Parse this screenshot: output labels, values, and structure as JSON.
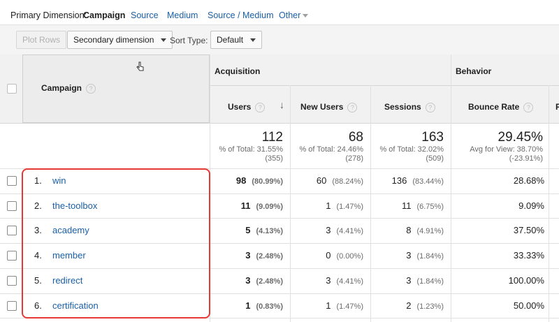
{
  "dimension_bar": {
    "label": "Primary Dimension:",
    "options": [
      "Campaign",
      "Source",
      "Medium",
      "Source / Medium",
      "Other"
    ],
    "selected": "Campaign"
  },
  "toolbar": {
    "plot_rows": "Plot Rows",
    "secondary_dimension": "Secondary dimension",
    "sort_type_label": "Sort Type:",
    "sort_type_value": "Default"
  },
  "table": {
    "group_headers": {
      "acquisition": "Acquisition",
      "behavior": "Behavior"
    },
    "columns": {
      "campaign": "Campaign",
      "users": "Users",
      "new_users": "New Users",
      "sessions": "Sessions",
      "bounce_rate": "Bounce Rate",
      "next": "P"
    },
    "help_glyph": "?",
    "sort_arrow": "↓",
    "totals": {
      "users": {
        "value": "112",
        "line1": "% of Total: 31.55%",
        "line2": "(355)"
      },
      "new_users": {
        "value": "68",
        "line1": "% of Total: 24.46%",
        "line2": "(278)"
      },
      "sessions": {
        "value": "163",
        "line1": "% of Total: 32.02%",
        "line2": "(509)"
      },
      "bounce_rate": {
        "value": "29.45%",
        "line1": "Avg for View: 38.70%",
        "line2": "(-23.91%)"
      }
    },
    "rows": [
      {
        "num": "1.",
        "campaign": "win",
        "users": "98",
        "users_pct": "(80.99%)",
        "new_users": "60",
        "new_users_pct": "(88.24%)",
        "sessions": "136",
        "sessions_pct": "(83.44%)",
        "bounce_rate": "28.68%"
      },
      {
        "num": "2.",
        "campaign": "the-toolbox",
        "users": "11",
        "users_pct": "(9.09%)",
        "new_users": "1",
        "new_users_pct": "(1.47%)",
        "sessions": "11",
        "sessions_pct": "(6.75%)",
        "bounce_rate": "9.09%"
      },
      {
        "num": "3.",
        "campaign": "academy",
        "users": "5",
        "users_pct": "(4.13%)",
        "new_users": "3",
        "new_users_pct": "(4.41%)",
        "sessions": "8",
        "sessions_pct": "(4.91%)",
        "bounce_rate": "37.50%"
      },
      {
        "num": "4.",
        "campaign": "member",
        "users": "3",
        "users_pct": "(2.48%)",
        "new_users": "0",
        "new_users_pct": "(0.00%)",
        "sessions": "3",
        "sessions_pct": "(1.84%)",
        "bounce_rate": "33.33%"
      },
      {
        "num": "5.",
        "campaign": "redirect",
        "users": "3",
        "users_pct": "(2.48%)",
        "new_users": "3",
        "new_users_pct": "(4.41%)",
        "sessions": "3",
        "sessions_pct": "(1.84%)",
        "bounce_rate": "100.00%"
      },
      {
        "num": "6.",
        "campaign": "certification",
        "users": "1",
        "users_pct": "(0.83%)",
        "new_users": "1",
        "new_users_pct": "(1.47%)",
        "sessions": "2",
        "sessions_pct": "(1.23%)",
        "bounce_rate": "50.00%"
      }
    ]
  },
  "colors": {
    "link": "#1a5fa8",
    "highlight": "#e53935",
    "header_bg": "#f1f1f1"
  },
  "icons": [
    "help-icon",
    "sort-down-arrow-icon",
    "chevron-down-icon",
    "pointer-cursor-icon",
    "checkbox-icon"
  ]
}
